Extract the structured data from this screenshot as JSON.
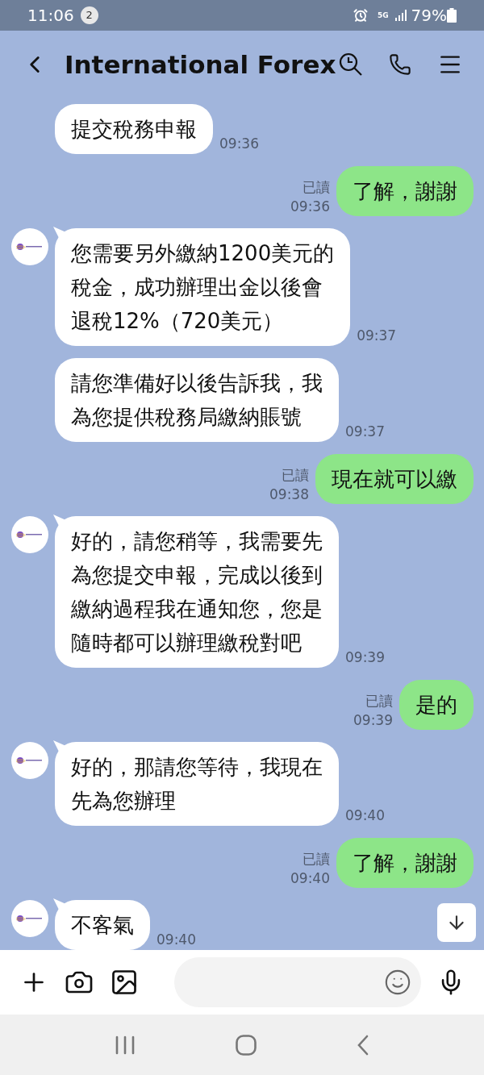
{
  "status_bar": {
    "time": "11:06",
    "notification_count": "2",
    "network": "5G",
    "battery": "79%"
  },
  "header": {
    "title": "International Forex"
  },
  "messages": [
    {
      "kind": "received",
      "avatar": false,
      "lines": [
        "提交稅務申報"
      ],
      "time": "09:36"
    },
    {
      "kind": "sent",
      "lines": [
        "了解，謝謝"
      ],
      "read": "已讀",
      "time": "09:36"
    },
    {
      "kind": "received",
      "avatar": true,
      "lines": [
        "您需要另外繳納1200美元的",
        "稅金，成功辦理出金以後會",
        "退稅12%（720美元）"
      ],
      "time": "09:37"
    },
    {
      "kind": "received",
      "avatar": false,
      "lines": [
        "請您準備好以後告訴我，我",
        "為您提供稅務局繳納賬號"
      ],
      "time": "09:37"
    },
    {
      "kind": "sent",
      "lines": [
        "現在就可以繳"
      ],
      "read": "已讀",
      "time": "09:38"
    },
    {
      "kind": "received",
      "avatar": true,
      "lines": [
        "好的，請您稍等，我需要先",
        "為您提交申報，完成以後到",
        "繳納過程我在通知您，您是",
        "隨時都可以辦理繳稅對吧"
      ],
      "time": "09:39"
    },
    {
      "kind": "sent",
      "lines": [
        "是的"
      ],
      "read": "已讀",
      "time": "09:39"
    },
    {
      "kind": "received",
      "avatar": true,
      "lines": [
        "好的，那請您等待，我現在",
        "先為您辦理"
      ],
      "time": "09:40"
    },
    {
      "kind": "sent",
      "lines": [
        "了解，謝謝"
      ],
      "read": "已讀",
      "time": "09:40"
    },
    {
      "kind": "received",
      "avatar": true,
      "lines": [
        "不客氣"
      ],
      "time": "09:40"
    }
  ]
}
